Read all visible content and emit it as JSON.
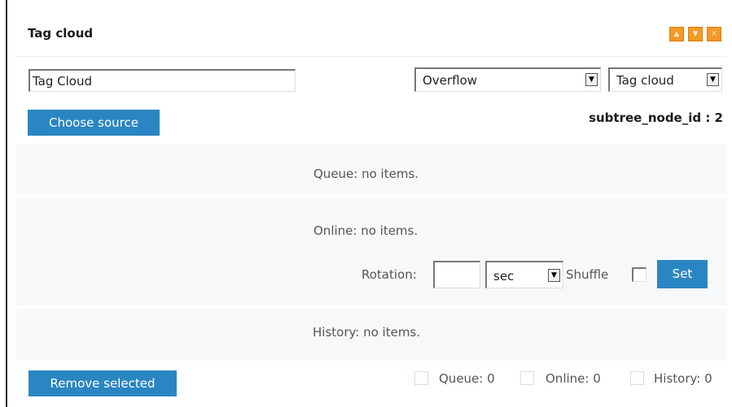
{
  "header": {
    "title": "Tag cloud",
    "buttons": [
      {
        "icon": "arrow-up-icon",
        "glyph": "▲"
      },
      {
        "icon": "arrow-down-icon",
        "glyph": "▼"
      },
      {
        "icon": "close-icon",
        "glyph": "✕"
      }
    ],
    "accent": "#f39a25"
  },
  "form": {
    "name_value": "Tag Cloud",
    "mode_select": {
      "value": "Overflow"
    },
    "type_select": {
      "value": "Tag cloud"
    },
    "choose_source_label": "Choose source",
    "subtree_label": "subtree_node_id : 2"
  },
  "lists": {
    "queue_text": "Queue: no items.",
    "online_text": "Online: no items.",
    "history_text": "History: no items."
  },
  "rotation": {
    "label": "Rotation:",
    "value": "",
    "unit": "sec",
    "shuffle_label": "Shuffle",
    "set_label": "Set"
  },
  "footer": {
    "remove_label": "Remove selected",
    "queue_count": "Queue: 0",
    "online_count": "Online: 0",
    "history_count": "History: 0"
  },
  "colors": {
    "button_blue": "#2a86c2",
    "band_bg": "#f7f8fa"
  }
}
